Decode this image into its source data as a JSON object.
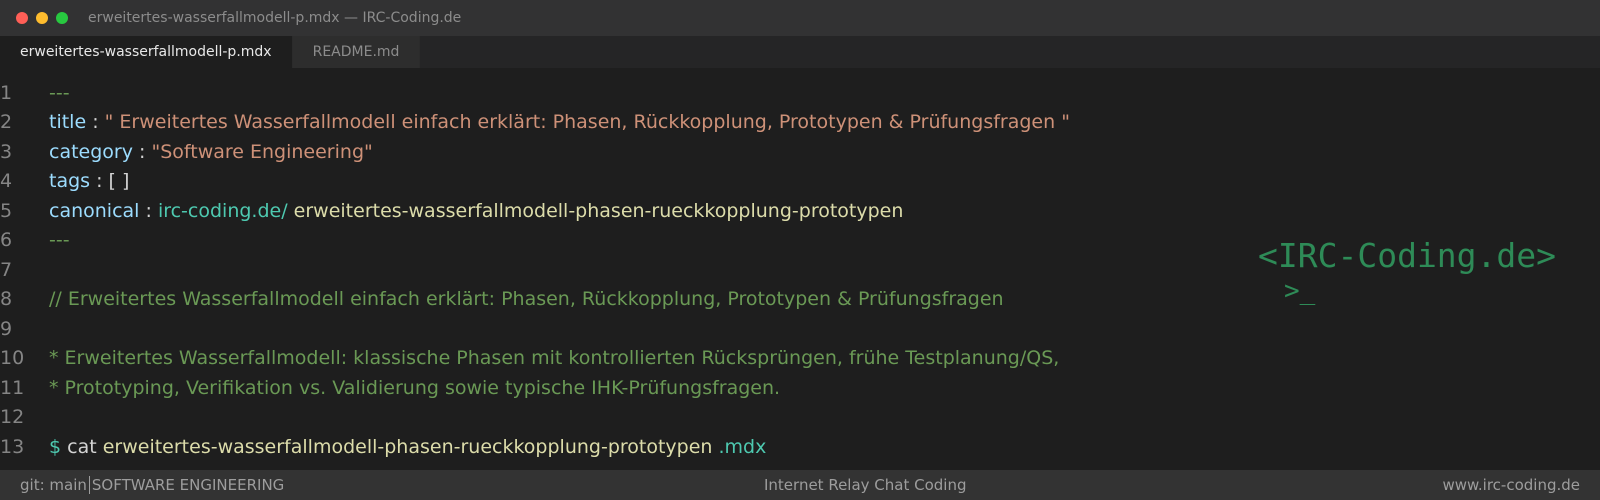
{
  "window": {
    "title": "erweitertes-wasserfallmodell-p.mdx — IRC-Coding.de",
    "traffic_lights": {
      "close": "#ff5f57",
      "minimize": "#febc2e",
      "maximize": "#28c840"
    }
  },
  "tabs": [
    {
      "label": "erweitertes-wasserfallmodell-p.mdx",
      "active": true
    },
    {
      "label": "README.md",
      "active": false
    }
  ],
  "editor": {
    "line_numbers": [
      "1",
      "2",
      "3",
      "4",
      "5",
      "6",
      "7",
      "8",
      "9",
      "10",
      "11",
      "12",
      "13"
    ],
    "line1": {
      "dashes": "---"
    },
    "line2": {
      "key": "title",
      "sep": " : ",
      "value": "\" Erweitertes Wasserfallmodell einfach erklärt: Phasen, Rückkopplung, Prototypen & Prüfungsfragen \""
    },
    "line3": {
      "key": "category",
      "sep": " : ",
      "value": "\"Software Engineering\""
    },
    "line4": {
      "key": "tags",
      "sep": " : ",
      "value": "[ ]"
    },
    "line5": {
      "key": "canonical",
      "sep": " : ",
      "domain": "irc-coding.de/",
      "path": " erweitertes-wasserfallmodell-phasen-rueckkopplung-prototypen"
    },
    "line6": {
      "dashes": "---"
    },
    "line8": {
      "comment": "// Erweitertes Wasserfallmodell einfach erklärt: Phasen, Rückkopplung, Prototypen & Prüfungsfragen"
    },
    "line10": {
      "comment": "* Erweitertes Wasserfallmodell: klassische Phasen mit kontrollierten Rücksprüngen, frühe Testplanung/QS,"
    },
    "line11": {
      "comment": "* Prototyping, Verifikation vs. Validierung sowie typische IHK-Prüfungsfragen."
    },
    "line13": {
      "prompt": "$",
      "command": " cat ",
      "file": "erweitertes-wasserfallmodell-phasen-rueckkopplung-prototypen",
      "extension": " .mdx"
    }
  },
  "logo": {
    "text": "<IRC-Coding.de>",
    "cursor": ">_"
  },
  "statusbar": {
    "branch": "git: main",
    "category": "SOFTWARE ENGINEERING",
    "center": "Internet Relay Chat Coding",
    "right": "www.irc-coding.de"
  }
}
